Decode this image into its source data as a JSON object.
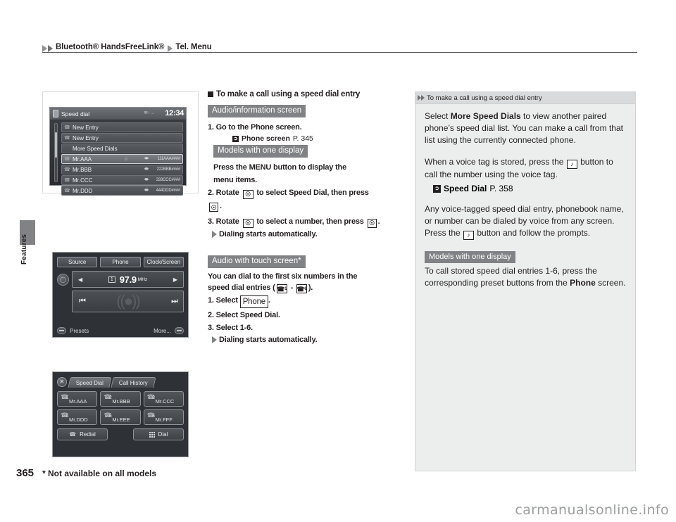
{
  "header": {
    "crumb1": "Bluetooth® HandsFreeLink®",
    "crumb2": "Tel. Menu"
  },
  "side_tab_label": "Features",
  "nav_screen": {
    "title": "Speed dial",
    "status": "✉↑→",
    "clock": "12:34",
    "rows": [
      {
        "name": "New Entry",
        "number": "",
        "selected": false,
        "voicetag": false
      },
      {
        "name": "New Entry",
        "number": "",
        "selected": false,
        "voicetag": false
      },
      {
        "name": "More Speed Dials",
        "number": "",
        "selected": false,
        "voicetag": false
      },
      {
        "name": "Mr.AAA",
        "number": "111AAA####",
        "selected": true,
        "voicetag": true
      },
      {
        "name": "Mr.BBB",
        "number": "222BBB####",
        "selected": false,
        "voicetag": false
      },
      {
        "name": "Mr.CCC",
        "number": "333CCC####",
        "selected": false,
        "voicetag": false
      },
      {
        "name": "Mr.DDD",
        "number": "444DDD####",
        "selected": false,
        "voicetag": false
      }
    ]
  },
  "audio_screen": {
    "tabs": [
      "Source",
      "Phone",
      "Clock/Screen"
    ],
    "preset_number": "1",
    "frequency": "97.9",
    "unit": "MHz",
    "left_arrow": "◀",
    "right_arrow": "▶",
    "seek_prev": "⏮",
    "seek_next": "⏭",
    "presets_label": "Presets",
    "more_label": "More..."
  },
  "speed_dial_screen": {
    "close": "✕",
    "tabs": [
      "Speed Dial",
      "Call History"
    ],
    "active_tab": "Speed Dial",
    "entries": [
      {
        "index": "1",
        "name": "Mr.AAA"
      },
      {
        "index": "2",
        "name": "Mr.BBB"
      },
      {
        "index": "3",
        "name": "Mr.CCC"
      },
      {
        "index": "4",
        "name": "Mr.DDD"
      },
      {
        "index": "5",
        "name": "Mr.EEE"
      },
      {
        "index": "6",
        "name": "Mr.FFF"
      }
    ],
    "redial_label": "Redial",
    "dial_label": "Dial"
  },
  "main": {
    "section_title": "To make a call using a speed dial entry",
    "band_audio_info": "Audio/information screen",
    "step1": "1. Go to the Phone screen.",
    "ref1_text": "Phone screen",
    "ref1_page": "P. 345",
    "band_one_display_a": "Models with one display",
    "one_display_text_a": "Press the MENU button to display the",
    "one_display_text_b": "menu items.",
    "step2_a": "2. Rotate",
    "step2_b": "to select",
    "step2_bold": "Speed Dial",
    "step2_c": ", then press",
    "step2_d": ".",
    "step3_a": "3. Rotate",
    "step3_b": "to select a number, then press",
    "step3_c": ".",
    "bullet_dialing": "Dialing starts automatically.",
    "band_touch": "Audio with touch screen*",
    "touch_intro_a": "You can dial to the first six numbers in the",
    "touch_intro_b": "speed dial entries (",
    "touch_intro_c": " - ",
    "touch_intro_d": ").",
    "touch_step1_a": "1. Select",
    "touch_step1_btn": "Phone",
    "touch_step1_b": ".",
    "touch_step2": "2. Select Speed Dial.",
    "touch_step3": "3. Select 1-6.",
    "touch_bullet": "Dialing starts automatically."
  },
  "sidebar": {
    "title": "To make a call using a speed dial entry",
    "p1_pre": "Select ",
    "p1_bold": "More Speed Dials",
    "p1_post": " to view another paired phone’s speed dial list. You can make a call from that list using the currently connected phone.",
    "p2_pre": "When a voice tag is stored, press the ",
    "p2_post": " button to call the number using the voice tag.",
    "ref_bold": "Speed Dial",
    "ref_page": "P. 358",
    "p3_pre": "Any voice-tagged speed dial entry, phonebook name, or number can be dialed by voice from any screen. Press the ",
    "p3_post": " button and follow the prompts.",
    "band_one_display": "Models with one display",
    "p4_pre": "To call stored speed dial entries 1-6, press the corresponding preset buttons from the ",
    "p4_bold": "Phone",
    "p4_post": " screen."
  },
  "footer": {
    "page_number": "365",
    "note": "* Not available on all models",
    "watermark": "carmanualsonline.info"
  }
}
